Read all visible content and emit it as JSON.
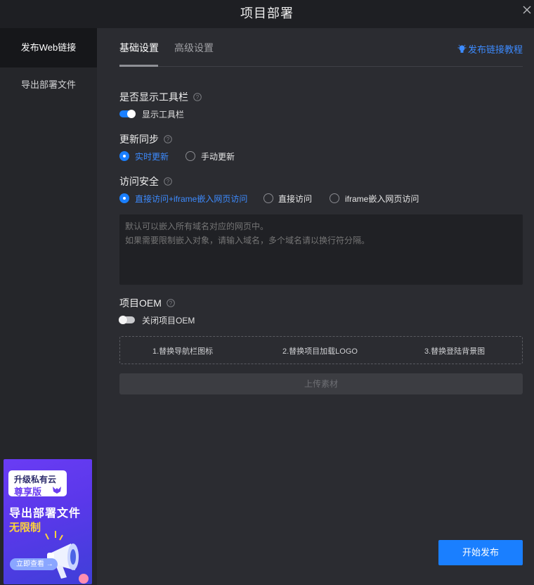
{
  "window": {
    "title": "项目部署"
  },
  "sidebar": {
    "items": [
      {
        "label": "发布Web链接"
      },
      {
        "label": "导出部署文件"
      }
    ]
  },
  "promo": {
    "line1": "升级私有云",
    "line2": "尊享版",
    "line3": "导出部署文件",
    "line4": "无限制",
    "button": "立即查看 →"
  },
  "tabs": [
    {
      "label": "基础设置"
    },
    {
      "label": "高级设置"
    }
  ],
  "tutorial_link": "发布链接教程",
  "toolbar_section": {
    "label": "是否显示工具栏",
    "switch_label": "显示工具栏",
    "switch_on": true
  },
  "sync_section": {
    "label": "更新同步",
    "options": [
      "实时更新",
      "手动更新"
    ],
    "selected": "实时更新"
  },
  "security_section": {
    "label": "访问安全",
    "options": [
      "直接访问+iframe嵌入网页访问",
      "直接访问",
      "iframe嵌入网页访问"
    ],
    "selected": "直接访问+iframe嵌入网页访问",
    "placeholder": "默认可以嵌入所有域名对应的网页中。\n如果需要限制嵌入对象，请输入域名，多个域名请以换行符分隔。"
  },
  "oem_section": {
    "label": "项目OEM",
    "switch_label": "关闭项目OEM",
    "switch_on": false,
    "steps": [
      "1.替换导航栏图标",
      "2.替换项目加载LOGO",
      "3.替换登陆背景图"
    ],
    "upload_label": "上传素材"
  },
  "publish_button": "开始发布",
  "colors": {
    "accent": "#1a7fff",
    "promo_highlight": "#ffd43b"
  }
}
